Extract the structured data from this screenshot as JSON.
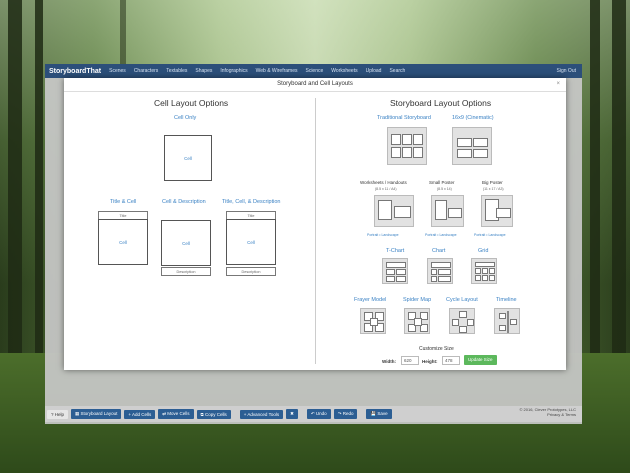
{
  "app": {
    "logo": "StoryboardThat",
    "nav": [
      "Scenes",
      "Characters",
      "Textables",
      "Shapes",
      "Infographics",
      "Web & Wireframes",
      "Science",
      "Worksheets",
      "Upload",
      "Search"
    ],
    "signout": "Sign Out"
  },
  "modal": {
    "title": "Storyboard and Cell Layouts",
    "close": "×",
    "cell_layout": {
      "heading": "Cell Layout Options",
      "cell_only": "Cell Only",
      "title_cell": "Title & Cell",
      "cell_desc": "Cell & Description",
      "title_cell_desc": "Title, Cell, & Description",
      "cell_text": "Cell",
      "title_text": "Title",
      "desc_text": "Description"
    },
    "storyboard_layout": {
      "heading": "Storyboard Layout Options",
      "traditional": "Traditional Storyboard",
      "cinematic": "16x9 (Cinematic)",
      "worksheets": "Worksheets / Handouts",
      "worksheets_size": "(8.5 x 11 / A4)",
      "small_poster": "Small Poster",
      "small_poster_size": "(8.5 x 14)",
      "big_poster": "Big Poster",
      "big_poster_size": "(11 x 17 / A3)",
      "portrait_landscape": "Portrait • Landscape",
      "tchart": "T-Chart",
      "chart": "Chart",
      "grid": "Grid",
      "frayer": "Frayer Model",
      "spider": "Spider Map",
      "cycle": "Cycle Layout",
      "timeline": "Timeline",
      "customize": "Customize Size",
      "width_label": "Width:",
      "width_value": "620",
      "height_label": "Height:",
      "height_value": "478",
      "update_button": "Update Size"
    }
  },
  "toolbar": {
    "help": "Help",
    "storyboard_layout": "Storyboard Layout",
    "add_cells": "Add Cells",
    "move_cells": "Move Cells",
    "copy_cells": "Copy Cells",
    "advanced_tools": "Advanced Tools",
    "undo": "Undo",
    "redo": "Redo",
    "save": "Save"
  },
  "footer": {
    "copyright": "© 2016, Clever Prototypes, LLC",
    "privacy": "Privacy & Terms"
  }
}
